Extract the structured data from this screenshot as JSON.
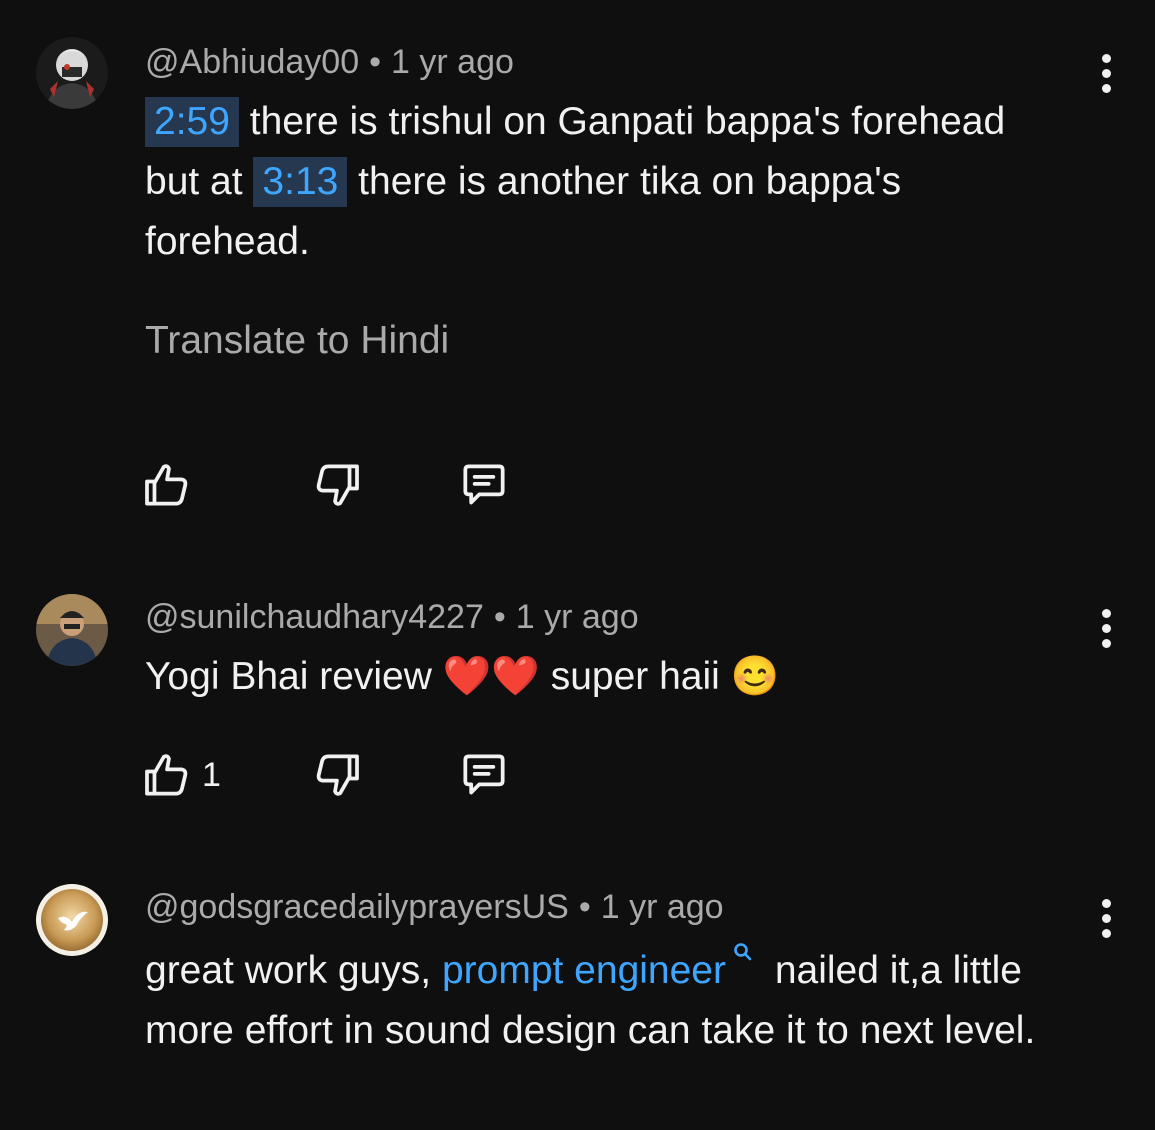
{
  "comments": [
    {
      "username": "@Abhiuday00",
      "separator": "•",
      "time": "1 yr ago",
      "timestamp_1": "2:59",
      "text_1": " there is trishul on Ganpati bappa's forehead but at ",
      "timestamp_2": "3:13",
      "text_2": " there is another tika on bappa's forehead.",
      "translate_label": "Translate to Hindi",
      "likes": ""
    },
    {
      "username": "@sunilchaudhary4227",
      "separator": "•",
      "time": "1 yr ago",
      "text_1": "Yogi Bhai review ",
      "text_2": " super haii ",
      "emoji_hearts": "❤️❤️",
      "emoji_smile": "😊",
      "likes": "1"
    },
    {
      "username": "@godsgracedailyprayersUS",
      "separator": "•",
      "time": "1 yr ago",
      "text_1": "great work guys, ",
      "link_text": "prompt engineer",
      "text_2": " nailed it,a little more effort in sound design can take it to next level.",
      "likes": ""
    }
  ],
  "icons": {
    "like": "thumbs-up-icon",
    "dislike": "thumbs-down-icon",
    "reply": "reply-icon",
    "more": "more-vert-icon",
    "search": "search-icon"
  },
  "colors": {
    "background": "#0f0f0f",
    "text": "#f1f1f1",
    "secondary": "#aaaaaa",
    "link": "#3ea6ff",
    "timestamp_bg": "#263850"
  }
}
